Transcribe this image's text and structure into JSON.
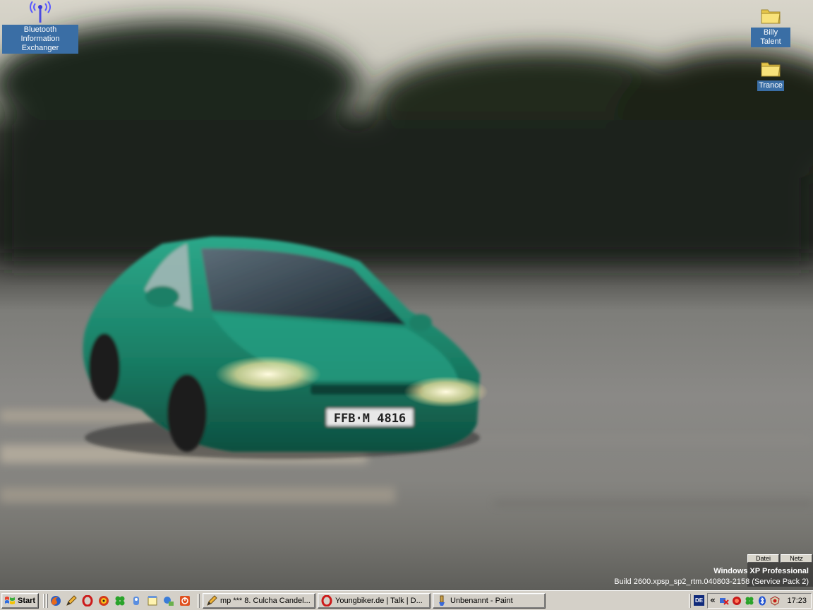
{
  "desktop": {
    "icons": [
      {
        "label": "Bluetooth Information Exchanger",
        "icon": "bluetooth-antenna-icon"
      },
      {
        "label": "Billy Talent",
        "icon": "folder-icon"
      },
      {
        "label": "Trance",
        "icon": "folder-icon"
      }
    ],
    "mini_panel": {
      "left_label": "Datei",
      "right_label": "Netz"
    },
    "watermark": {
      "line1": "Windows XP Professional",
      "line2": "Build 2600.xpsp_sp2_rtm.040803-2158 (Service Pack 2)"
    },
    "wallpaper": {
      "license_plate": "FFB·M 4816",
      "car_color": "#1f8a6e"
    }
  },
  "taskbar": {
    "start_label": "Start",
    "quick_launch": [
      "firefox-icon",
      "pencil-icon",
      "opera-icon",
      "cd-burn-icon",
      "clover-icon",
      "media-icon",
      "notepad-icon",
      "network-icon",
      "power-icon"
    ],
    "tasks": [
      {
        "label": "mp *** 8. Culcha Candel...",
        "icon": "pencil-icon"
      },
      {
        "label": "Youngbiker.de | Talk | D...",
        "icon": "opera-icon"
      },
      {
        "label": "Unbenannt - Paint",
        "icon": "paint-icon"
      }
    ],
    "tray": {
      "language": "DE",
      "expand_label": "«",
      "clock": "17:23"
    }
  },
  "colors": {
    "desktop_selection": "#3a6ea5",
    "taskbar_bg": "#d4d0c8"
  }
}
